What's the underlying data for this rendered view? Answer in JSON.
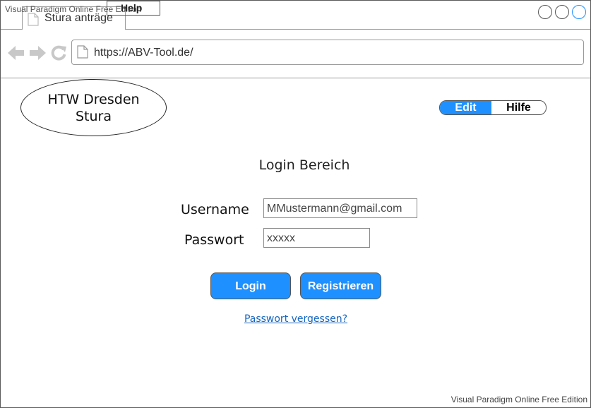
{
  "browser": {
    "tab_title": "Stura anträge",
    "help_label": "Help",
    "url": "https://ABV-Tool.de/"
  },
  "header": {
    "logo_line1": "HTW Dresden",
    "logo_line2": "Stura",
    "toggle": {
      "active": "Edit",
      "inactive": "Hilfe",
      "active_color": "#1e90ff"
    }
  },
  "login": {
    "title": "Login Bereich",
    "username_label": "Username",
    "username_value": "MMustermann@gmail.com",
    "password_label": "Passwort",
    "password_value": "xxxxx",
    "login_button": "Login",
    "register_button": "Registrieren",
    "forgot_link": "Passwort vergessen?"
  },
  "watermark": "Visual Paradigm Online Free Edition",
  "colors": {
    "accent": "#1e90ff",
    "link": "#1565c0"
  }
}
